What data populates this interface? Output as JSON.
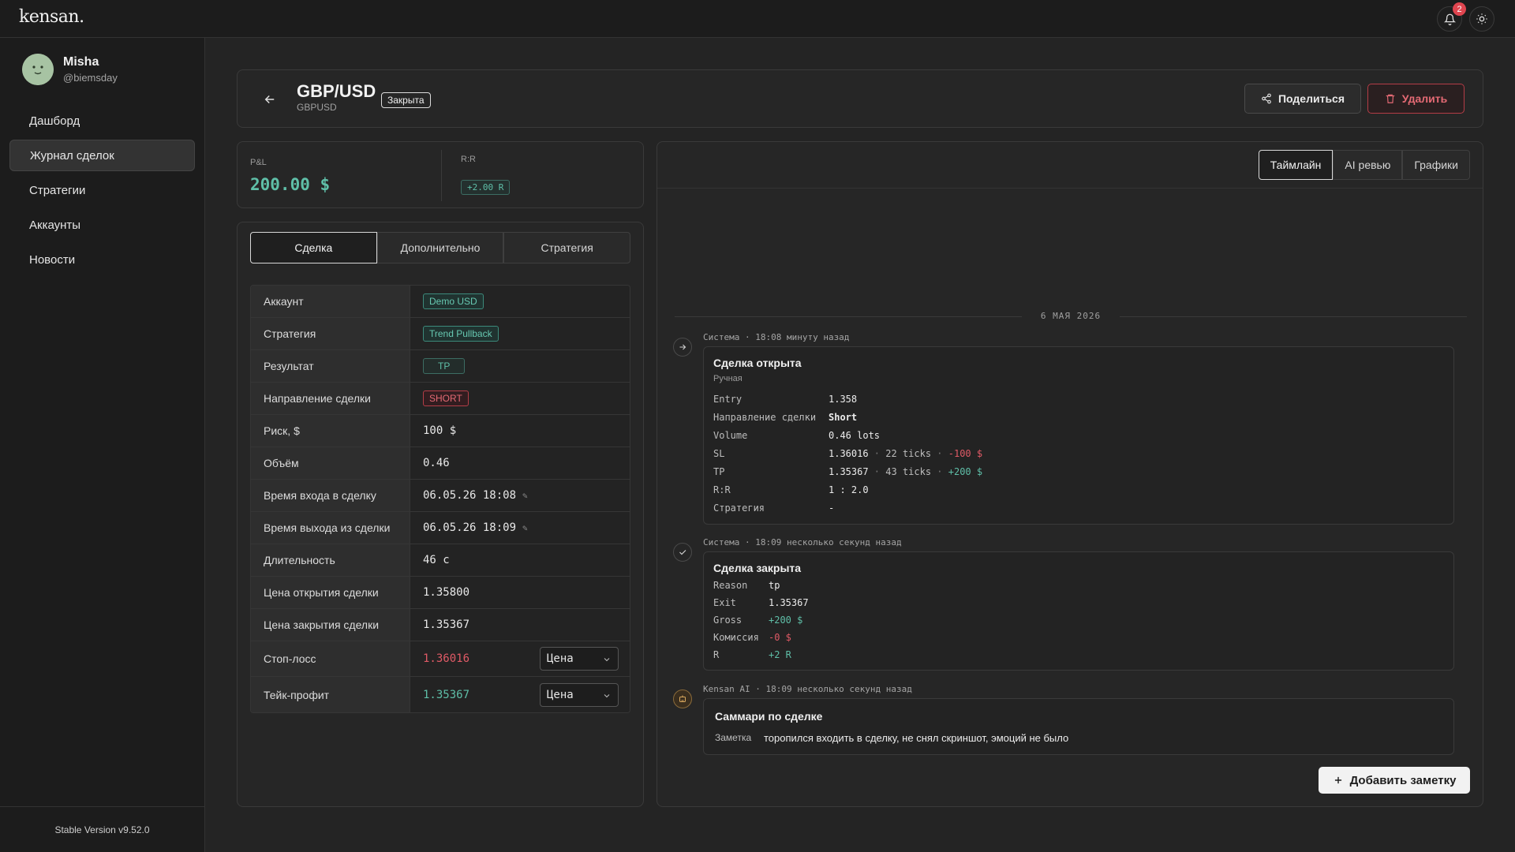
{
  "app": {
    "logo": "kensan.",
    "notifications_count": "2"
  },
  "user": {
    "name": "Misha",
    "handle": "@biemsday"
  },
  "sidebar": {
    "items": [
      {
        "label": "Дашборд"
      },
      {
        "label": "Журнал сделок"
      },
      {
        "label": "Стратегии"
      },
      {
        "label": "Аккаунты"
      },
      {
        "label": "Новости"
      }
    ],
    "active": "Журнал сделок",
    "version": "Stable Version v9.52.0"
  },
  "trade": {
    "pair": "GBP/USD",
    "symbol": "GBPUSD",
    "status": "Закрыта",
    "share_label": "Поделиться",
    "delete_label": "Удалить"
  },
  "summary": {
    "pl_label": "P&L",
    "pl_value": "200.00 $",
    "rr_label": "R:R",
    "rr_value": "+2.00 R"
  },
  "detail_tabs": [
    "Сделка",
    "Дополнительно",
    "Стратегия"
  ],
  "details": {
    "account": {
      "label": "Аккаунт",
      "value": "Demo USD"
    },
    "strategy": {
      "label": "Стратегия",
      "value": "Trend Pullback"
    },
    "result": {
      "label": "Результат",
      "value": "TP"
    },
    "direction": {
      "label": "Направление сделки",
      "value": "SHORT"
    },
    "risk": {
      "label": "Риск, $",
      "value": "100 $"
    },
    "volume": {
      "label": "Объём",
      "value": "0.46"
    },
    "entry_time": {
      "label": "Время входа в сделку",
      "value": "06.05.26 18:08"
    },
    "exit_time": {
      "label": "Время выхода из сделки",
      "value": "06.05.26 18:09"
    },
    "duration": {
      "label": "Длительность",
      "value": "46 с"
    },
    "open_price": {
      "label": "Цена открытия сделки",
      "value": "1.35800"
    },
    "close_price": {
      "label": "Цена закрытия сделки",
      "value": "1.35367"
    },
    "stop_loss": {
      "label": "Стоп-лосс",
      "value": "1.36016",
      "mode": "Цена"
    },
    "take_profit": {
      "label": "Тейк-профит",
      "value": "1.35367",
      "mode": "Цена"
    }
  },
  "timeline_tabs": [
    "Таймлайн",
    "AI ревью",
    "Графики"
  ],
  "timeline": {
    "date": "6 МАЯ 2026",
    "opened": {
      "meta": "Система · 18:08 минуту назад",
      "title": "Сделка открыта",
      "subtitle": "Ручная",
      "entry_k": "Entry",
      "entry_v": "1.358",
      "dir_k": "Направление сделки",
      "dir_v": "Short",
      "vol_k": "Volume",
      "vol_v": "0.46 lots",
      "sl_k": "SL",
      "sl_price": "1.36016",
      "sl_ticks": "22 ticks",
      "sl_amount": "-100 $",
      "tp_k": "TP",
      "tp_price": "1.35367",
      "tp_ticks": "43 ticks",
      "tp_amount": "+200 $",
      "rr_k": "R:R",
      "rr_v": "1 : 2.0",
      "strat_k": "Стратегия",
      "strat_v": "-"
    },
    "closed": {
      "meta": "Система · 18:09 несколько секунд назад",
      "title": "Сделка закрыта",
      "reason_k": "Reason",
      "reason_v": "tp",
      "exit_k": "Exit",
      "exit_v": "1.35367",
      "gross_k": "Gross",
      "gross_v": "+200 $",
      "comm_k": "Комиссия",
      "comm_v": "-0 $",
      "r_k": "R",
      "r_v": "+2 R"
    },
    "ai": {
      "meta": "Kensan AI · 18:09 несколько секунд назад",
      "title": "Саммари по сделке",
      "note_k": "Заметка",
      "note_v": "торопился входить в сделку, не снял скриншот, эмоций не было"
    },
    "add_note_label": "Добавить заметку"
  },
  "colors": {
    "accent_green": "#5fbfa8",
    "accent_red": "#e05a66",
    "bg": "#242424"
  }
}
